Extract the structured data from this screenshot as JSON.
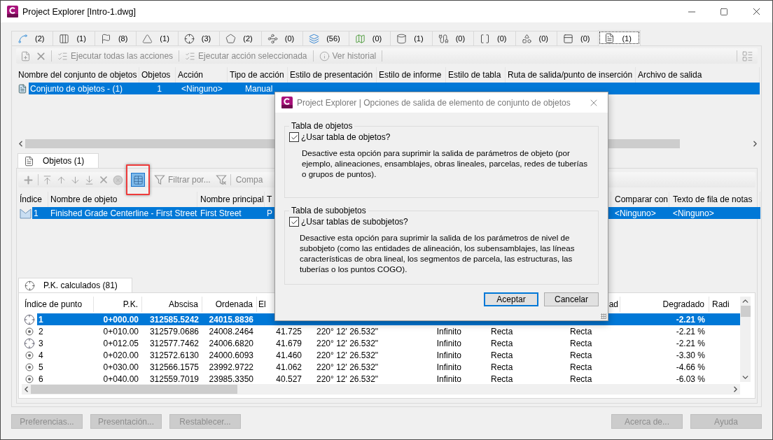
{
  "window": {
    "title": "Project Explorer [Intro-1.dwg]"
  },
  "type_tabs": [
    {
      "count": "(2)",
      "selected": false
    },
    {
      "count": "(1)",
      "selected": false
    },
    {
      "count": "(8)",
      "selected": false
    },
    {
      "count": "(1)",
      "selected": false
    },
    {
      "count": "(3)",
      "selected": false
    },
    {
      "count": "(2)",
      "selected": false
    },
    {
      "count": "(0)",
      "selected": false
    },
    {
      "count": "(56)",
      "selected": false
    },
    {
      "count": "(0)",
      "selected": false
    },
    {
      "count": "(1)",
      "selected": false
    },
    {
      "count": "(0)",
      "selected": false
    },
    {
      "count": "(0)",
      "selected": false
    },
    {
      "count": "(0)",
      "selected": false
    },
    {
      "count": "(0)",
      "selected": false
    },
    {
      "count": "(1)",
      "selected": true
    }
  ],
  "toolbar": [
    {
      "label": "Ejecutar todas las acciones",
      "disabled": true
    },
    {
      "label": "Ejecutar acción seleccionada",
      "disabled": true
    },
    {
      "label": "Ver historial",
      "disabled": true
    }
  ],
  "sets_table": {
    "columns": [
      "Nombre del conjunto de objetos",
      "Objetos",
      "Acción",
      "Tipo de acción",
      "Estilo de presentación",
      "Estilo de informe",
      "Estilo de tabla",
      "Ruta de salida/punto de inserción",
      "Archivo de salida"
    ],
    "rows": [
      {
        "selected": true,
        "cells": [
          "Conjunto de objetos - (1)",
          "1",
          "<Ninguno>",
          "Manual"
        ]
      }
    ]
  },
  "objects_tab": {
    "label": "Objetos (1)",
    "selected": true
  },
  "objects_toolbar": {
    "output_options": {
      "active": true,
      "highlighted": true
    },
    "items": [
      {
        "label": "Filtrar por...",
        "disabled": true
      },
      {
        "label": "Compa",
        "disabled": true
      }
    ]
  },
  "objects_table": {
    "columns": [
      "Índice",
      "Nombre de objeto",
      "Nombre principal",
      "T",
      "Comparar con",
      "Texto de fila de notas"
    ],
    "rows": [
      {
        "selected": true,
        "cells": [
          "1",
          "Finished Grade Centerline - First Street",
          "First Street",
          "P",
          "<Ninguno>",
          "<Ninguno>"
        ]
      }
    ]
  },
  "stations_tab": {
    "label": "P.K. calculados (81)",
    "selected": true
  },
  "stations_table": {
    "columns": [
      "Índice de punto",
      "P.K.",
      "Abscisa",
      "Ordenada",
      "El",
      null,
      null,
      null,
      "ad",
      "Degradado",
      "Radi"
    ],
    "rows": [
      {
        "kind": "crosshair",
        "selected": true,
        "cells": [
          "1",
          "0+000.00",
          "312585.5242",
          "24015.8836",
          null,
          null,
          null,
          null,
          null,
          "-2.21 %"
        ]
      },
      {
        "kind": "target",
        "selected": false,
        "cells": [
          "2",
          "0+010.00",
          "312579.0686",
          "24008.2464",
          "41.725",
          "220° 12' 26.532\"",
          "Infinito",
          "Recta",
          "Recta",
          "-2.21 %"
        ]
      },
      {
        "kind": "crosshair",
        "selected": false,
        "cells": [
          "3",
          "0+012.05",
          "312577.7462",
          "24006.6820",
          "41.679",
          "220° 12' 26.532\"",
          "Infinito",
          "Recta",
          "Recta",
          "-2.21 %"
        ]
      },
      {
        "kind": "target",
        "selected": false,
        "cells": [
          "4",
          "0+020.00",
          "312572.6130",
          "24000.6093",
          "41.460",
          "220° 12' 26.532\"",
          "Infinito",
          "Recta",
          "Recta",
          "-3.30 %"
        ]
      },
      {
        "kind": "target",
        "selected": false,
        "cells": [
          "5",
          "0+030.00",
          "312566.1575",
          "23992.9722",
          "41.062",
          "220° 12' 26.532\"",
          "Infinito",
          "Recta",
          "Recta",
          "-4.66 %"
        ]
      },
      {
        "kind": "target",
        "selected": false,
        "cells": [
          "6",
          "0+040.00",
          "312559.7019",
          "23985.3350",
          "40.527",
          "220° 12' 26.532\"",
          "Infinito",
          "Recta",
          "Recta",
          "-6.03 %"
        ]
      }
    ]
  },
  "footer": {
    "left": [
      {
        "label": "Preferencias...",
        "disabled": true
      },
      {
        "label": "Presentación...",
        "disabled": true
      },
      {
        "label": "Restablecer...",
        "disabled": true
      }
    ],
    "right": [
      {
        "label": "Acerca de...",
        "disabled": true
      },
      {
        "label": "Ayuda",
        "disabled": true
      }
    ]
  },
  "dialog": {
    "title": "Project Explorer | Opciones de salida de elemento de conjunto de objetos",
    "groups": [
      {
        "title": "Tabla de objetos",
        "checkbox": {
          "label": "¿Usar tabla de objetos?",
          "checked": true
        },
        "description": "Desactive esta opción para suprimir la salida de parámetros de objeto (por ejemplo, alineaciones, ensamblajes, obras lineales, parcelas, redes de tuberías o grupos de puntos)."
      },
      {
        "title": "Tabla de subobjetos",
        "checkbox": {
          "label": "¿Usar tablas de subobjetos?",
          "checked": true
        },
        "description": "Desactive esta opción para suprimir la salida de los parámetros de nivel de subobjeto (como las entidades de alineación, los subensamblajes, las líneas características de obra lineal, los segmentos de parcela, las estructuras, las tuberías o los puntos COGO)."
      }
    ],
    "buttons": [
      {
        "label": "Aceptar",
        "default": true
      },
      {
        "label": "Cancelar",
        "default": false
      }
    ]
  }
}
